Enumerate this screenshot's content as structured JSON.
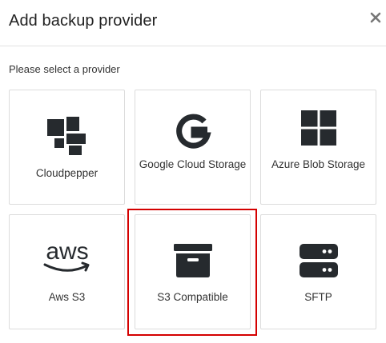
{
  "dialog": {
    "title": "Add backup provider",
    "subtitle": "Please select a provider",
    "close_icon": "close-icon"
  },
  "providers": [
    {
      "label": "Cloudpepper",
      "icon": "cloudpepper-logo-icon"
    },
    {
      "label": "Google Cloud Storage",
      "icon": "google-logo-icon"
    },
    {
      "label": "Azure Blob Storage",
      "icon": "windows-logo-icon"
    },
    {
      "label": "Aws S3",
      "icon": "aws-logo-icon",
      "logo_text": "aws"
    },
    {
      "label": "S3 Compatible",
      "icon": "archive-box-icon"
    },
    {
      "label": "SFTP",
      "icon": "server-icon"
    }
  ],
  "highlighted_provider": "S3 Compatible",
  "colors": {
    "icon": "#262a2e",
    "highlight": "#d40000",
    "border": "#dcdcdc"
  }
}
